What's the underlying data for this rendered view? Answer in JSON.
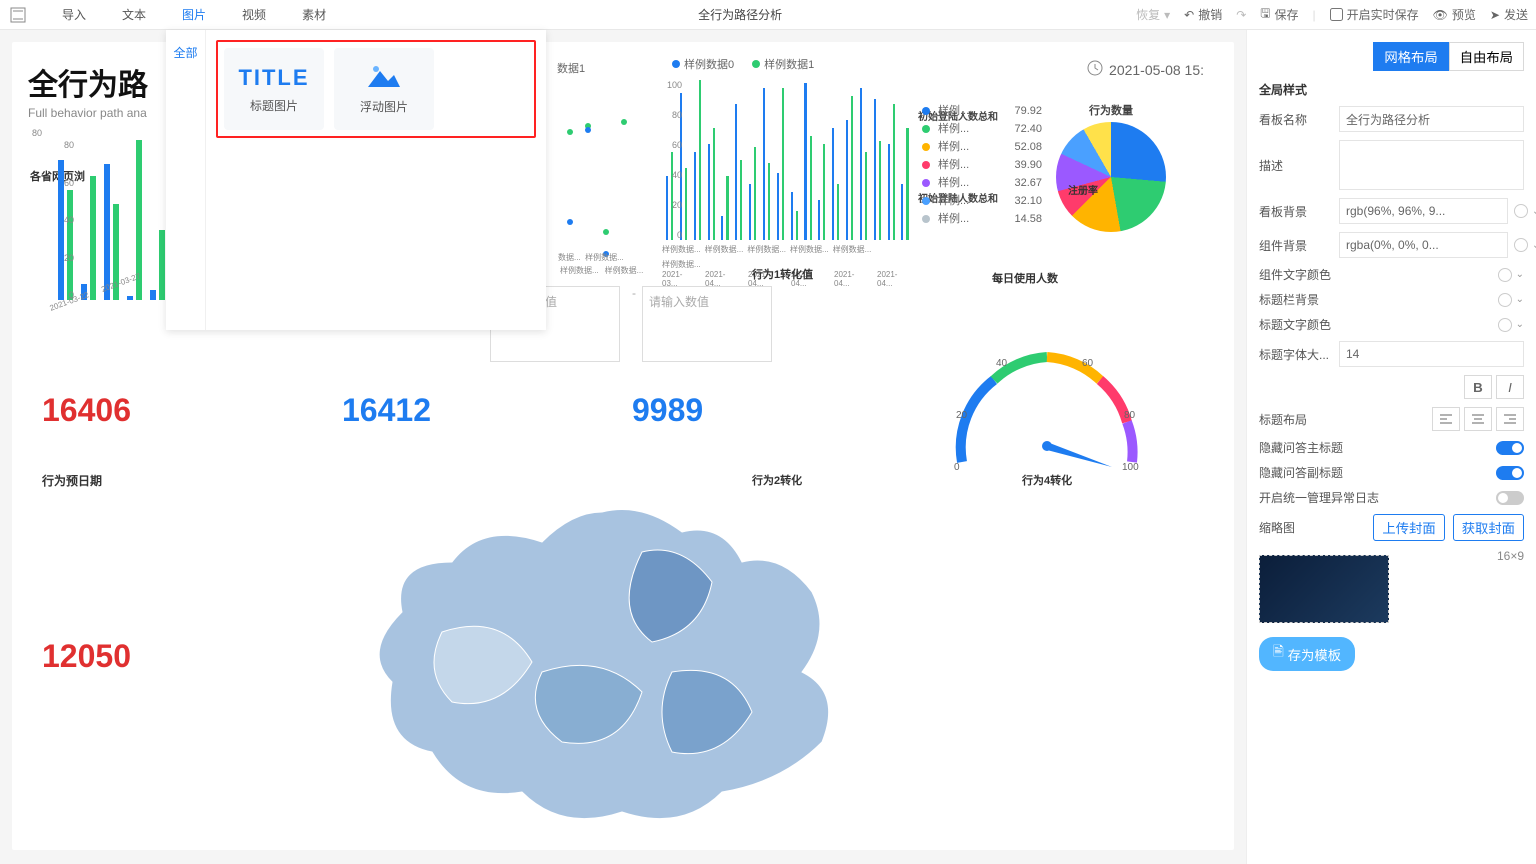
{
  "topbar": {
    "menu": [
      "导入",
      "文本",
      "图片",
      "视频",
      "素材"
    ],
    "menu_active_index": 2,
    "title": "全行为路径分析",
    "restore": "恢复",
    "undo": "撤销",
    "save": "保存",
    "realtime_save": "开启实时保存",
    "preview": "预览",
    "send": "发送"
  },
  "dropdown": {
    "side_all": "全部",
    "card1_icon": "TITLE",
    "card1_label": "标题图片",
    "card2_label": "浮动图片"
  },
  "dash": {
    "title": "全行为路径分析",
    "title_clipped": "全行为路",
    "subtitle": "Full behavior path ana",
    "timestamp": "2021-05-08 15:",
    "section_province": "各省网页浏",
    "chart1_legend0": "样例数据0",
    "chart1_legend1": "样例数据1",
    "chart2_legend0": "样例数据0",
    "chart2_legend1": "样例数据1",
    "chart1_annot1": "初始登陆人数总和",
    "chart1_annot2": "初始登陆人数总和",
    "row1_label": "行为1转化值",
    "input_placeholder": "请输入数值",
    "num_red": "16406",
    "num_blue1": "16412",
    "num_blue2": "9989",
    "behavior_date": "行为预日期",
    "num_red2": "12050",
    "map_title": "行为2转化",
    "gauge_title": "行为4转化",
    "gauge_ticks": [
      "0",
      "20",
      "40",
      "60",
      "80",
      "100"
    ],
    "pie_title": "行为数量",
    "pie_label": "注册率",
    "daily_use": "每日使用人数",
    "pie_legend": [
      {
        "name": "样例...",
        "value": "79.92",
        "color": "#1e7cf0"
      },
      {
        "name": "样例...",
        "value": "72.40",
        "color": "#2ecc71"
      },
      {
        "name": "样例...",
        "value": "52.08",
        "color": "#ffb400"
      },
      {
        "name": "样例...",
        "value": "39.90",
        "color": "#ff3b6b"
      },
      {
        "name": "样例...",
        "value": "32.67",
        "color": "#9b59ff"
      },
      {
        "name": "样例...",
        "value": "32.10",
        "color": "#4aa0ff"
      },
      {
        "name": "样例...",
        "value": "14.58",
        "color": "#b8c4cc"
      }
    ]
  },
  "chart_data": [
    {
      "type": "bar",
      "title": "各省网页浏览",
      "categories": [
        "2021-03-22",
        "2021-03-27"
      ],
      "series": [
        {
          "name": "样例数据0",
          "values": [
            70,
            8,
            68,
            2,
            5
          ],
          "color": "#1e7cf0"
        },
        {
          "name": "样例数据1",
          "values": [
            55,
            62,
            48,
            80,
            35
          ],
          "color": "#2ecc71"
        }
      ],
      "ylim": [
        0,
        80
      ],
      "yticks": [
        0,
        20,
        40,
        60,
        80
      ]
    },
    {
      "type": "bar",
      "title": "初始登陆人数",
      "categories": [
        "样例数据...",
        "样例数据...",
        "样例数据...",
        "样例数据...",
        "样例数据...",
        "样例数据...",
        "样例数据...",
        "样例数据...",
        "样例数据...",
        "样例数据...",
        "样例数据...",
        "样例数据...",
        "样例数据...",
        "样例数据...",
        "样例数据...",
        "样例数据...",
        "样例数据...",
        "样例数据..."
      ],
      "xsub": [
        "2021-03...",
        "2021-04...",
        "2021-04...",
        "2021-04...",
        "2021-04...",
        "2021-04..."
      ],
      "series": [
        {
          "name": "样例数据0",
          "values": [
            40,
            92,
            55,
            60,
            15,
            85,
            35,
            95,
            42,
            30,
            98,
            25,
            70,
            75,
            95,
            88,
            60,
            35
          ],
          "color": "#1e7cf0"
        },
        {
          "name": "样例数据1",
          "values": [
            55,
            45,
            100,
            70,
            40,
            50,
            58,
            48,
            95,
            18,
            65,
            60,
            35,
            90,
            55,
            62,
            85,
            70
          ],
          "color": "#2ecc71"
        }
      ],
      "ylim": [
        0,
        100
      ],
      "yticks": [
        0,
        20,
        40,
        60,
        80,
        100
      ]
    },
    {
      "type": "pie",
      "title": "行为数量",
      "slices": [
        {
          "name": "样例",
          "value": 79.92,
          "color": "#1e7cf0"
        },
        {
          "name": "样例",
          "value": 72.4,
          "color": "#2ecc71"
        },
        {
          "name": "样例",
          "value": 52.08,
          "color": "#ffb400"
        },
        {
          "name": "样例",
          "value": 39.9,
          "color": "#ff3b6b"
        },
        {
          "name": "样例",
          "value": 32.67,
          "color": "#9b59ff"
        },
        {
          "name": "样例",
          "value": 32.1,
          "color": "#4aa0ff"
        },
        {
          "name": "样例",
          "value": 14.58,
          "color": "#b8c4cc"
        }
      ]
    },
    {
      "type": "gauge",
      "title": "行为4转化",
      "value": 88,
      "min": 0,
      "max": 100,
      "ticks": [
        0,
        20,
        40,
        60,
        80,
        100
      ]
    }
  ],
  "panel": {
    "layout_grid": "网格布局",
    "layout_free": "自由布局",
    "global_style": "全局样式",
    "name_label": "看板名称",
    "name_value": "全行为路径分析",
    "desc_label": "描述",
    "bg_label": "看板背景",
    "bg_value": "rgb(96%, 96%, 9...",
    "comp_bg_label": "组件背景",
    "comp_bg_value": "rgba(0%, 0%, 0...",
    "comp_text_label": "组件文字颜色",
    "title_bg_label": "标题栏背景",
    "title_text_label": "标题文字颜色",
    "title_size_label": "标题字体大...",
    "title_size_value": "14",
    "title_layout_label": "标题布局",
    "hide_main_title": "隐藏问答主标题",
    "hide_sub_title": "隐藏问答副标题",
    "unified_log": "开启统一管理异常日志",
    "thumb_label": "缩略图",
    "upload_cover": "上传封面",
    "get_cover": "获取封面",
    "thumb_size": "16×9",
    "save_template": "存为模板"
  }
}
